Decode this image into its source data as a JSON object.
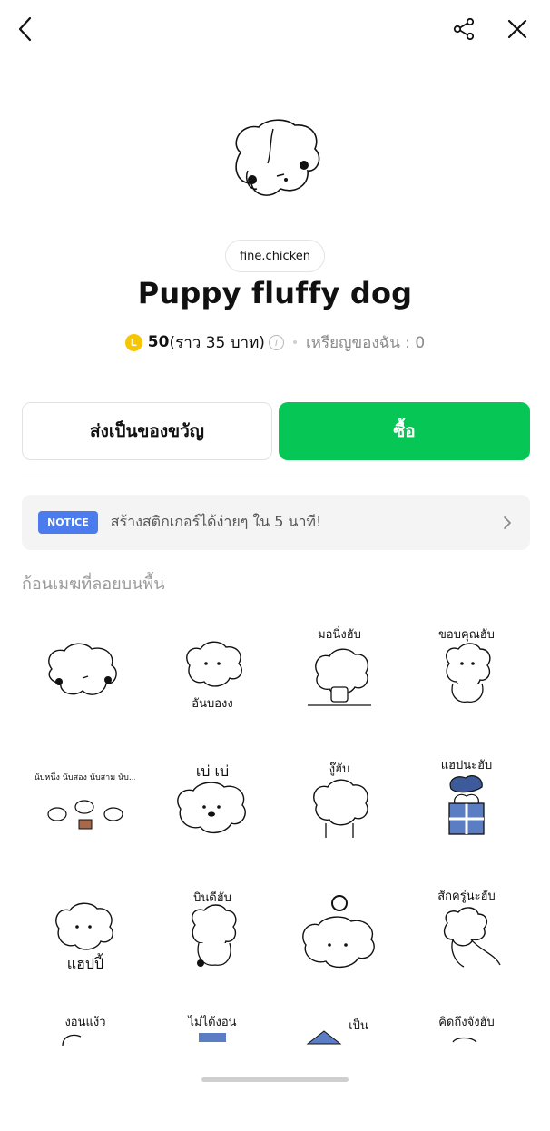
{
  "header": {
    "back_icon": "chevron-left-icon",
    "share_icon": "share-icon",
    "close_icon": "close-icon"
  },
  "product": {
    "author": "fine.chicken",
    "title": "Puppy fluffy dog",
    "coin_symbol": "L",
    "price": "50",
    "price_approx": "(ราว 35 บาท)",
    "separator": "•",
    "my_coins": "เหรียญของฉัน : 0"
  },
  "actions": {
    "gift_label": "ส่งเป็นของขวัญ",
    "buy_label": "ซื้อ",
    "buy_color": "#06c755"
  },
  "notice": {
    "badge": "NOTICE",
    "text": "สร้างสติกเกอร์ได้ง่ายๆ ใน 5 นาที!"
  },
  "section": {
    "label": "ก้อนเมฆที่ลอยบนพื้น"
  },
  "stickers": [
    {
      "caption": ""
    },
    {
      "caption": "อันบองง"
    },
    {
      "caption": "มอนิ่งฮับ"
    },
    {
      "caption": "ขอบคุณฮับ"
    },
    {
      "caption": "นับหนึ่ง นับสอง นับสาม นับ..."
    },
    {
      "caption": "เบ่ เบ่"
    },
    {
      "caption": "งู๊ฮับ"
    },
    {
      "caption": "แฮปนะฮับ"
    },
    {
      "caption": "แฮปปี้"
    },
    {
      "caption": "บินดีฮับ"
    },
    {
      "caption": ""
    },
    {
      "caption": "สักครู่นะฮับ"
    },
    {
      "caption": "งอนแง้ว"
    },
    {
      "caption": "ไม่ได้งอน"
    },
    {
      "caption": "เป็น"
    },
    {
      "caption": "คิดถึงจังฮับ"
    }
  ]
}
